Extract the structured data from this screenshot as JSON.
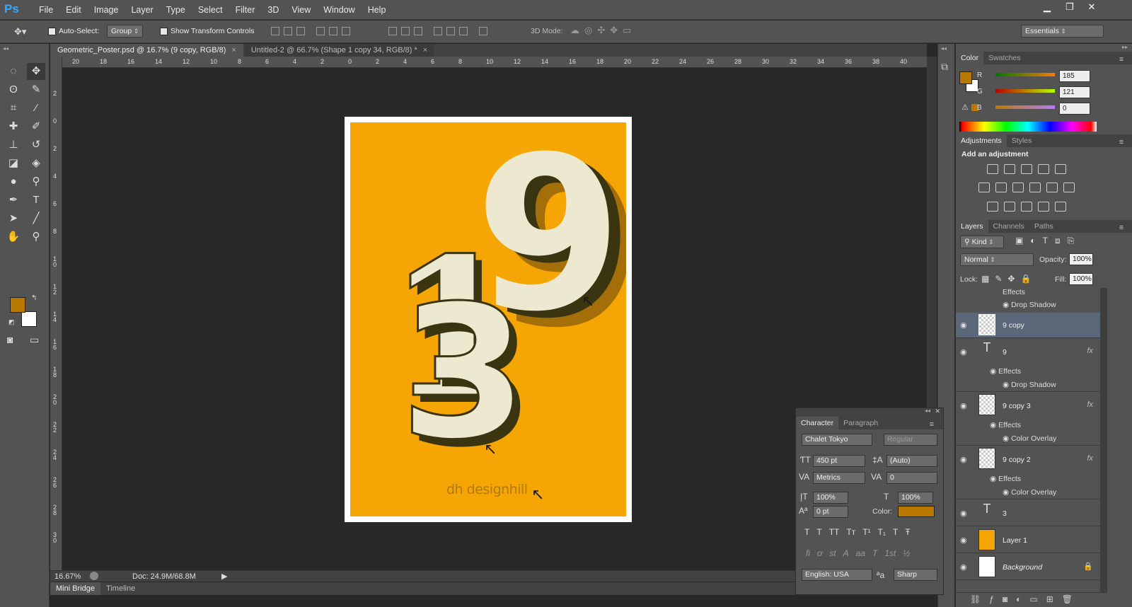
{
  "app": {
    "logo": "Ps"
  },
  "menu": [
    "File",
    "Edit",
    "Image",
    "Layer",
    "Type",
    "Select",
    "Filter",
    "3D",
    "View",
    "Window",
    "Help"
  ],
  "options": {
    "auto_select_label": "Auto-Select:",
    "auto_select_value": "Group",
    "show_transform_label": "Show Transform Controls",
    "mode3d_label": "3D Mode:",
    "workspace": "Essentials"
  },
  "doc_tabs": [
    {
      "label": "Geometric_Poster.psd @ 16.7% (9 copy, RGB/8)",
      "active": true
    },
    {
      "label": "Untitled-2 @ 66.7% (Shape 1 copy 34, RGB/8) *",
      "active": false
    }
  ],
  "ruler_h": [
    "20",
    "18",
    "16",
    "14",
    "12",
    "10",
    "8",
    "6",
    "4",
    "2",
    "0",
    "2",
    "4",
    "6",
    "8",
    "10",
    "12",
    "14",
    "16",
    "18",
    "20",
    "22",
    "24",
    "26",
    "28",
    "30",
    "32",
    "34",
    "36",
    "38",
    "40"
  ],
  "ruler_v": [
    "2",
    "0",
    "2",
    "4",
    "6",
    "8",
    "1 0",
    "1 2",
    "1 4",
    "1 6",
    "1 8",
    "2 0",
    "2 2",
    "2 4",
    "2 6",
    "2 8",
    "3 0"
  ],
  "poster": {
    "big_digits": [
      "1",
      "3",
      "9"
    ],
    "brand": "dh designhill",
    "bg_color": "#f5a504",
    "ink_color": "#ede8d0",
    "shadow_color": "#3a3510"
  },
  "status": {
    "zoom": "16.67%",
    "doc": "Doc: 24.9M/68.8M"
  },
  "bottom_tabs": [
    "Mini Bridge",
    "Timeline"
  ],
  "color_panel": {
    "tabs": [
      "Color",
      "Swatches"
    ],
    "fg_color": "#b97900",
    "r": {
      "label": "R",
      "value": "185"
    },
    "g": {
      "label": "G",
      "value": "121"
    },
    "b": {
      "label": "B",
      "value": "0"
    }
  },
  "adjustments": {
    "tabs": [
      "Adjustments",
      "Styles"
    ],
    "title": "Add an adjustment"
  },
  "layers_panel": {
    "tabs": [
      "Layers",
      "Channels",
      "Paths"
    ],
    "kind": "Kind",
    "blend": "Normal",
    "opacity_label": "Opacity:",
    "opacity": "100%",
    "lock_label": "Lock:",
    "fill_label": "Fill:",
    "fill": "100%",
    "top_effects": "Effects",
    "top_effect": "Drop Shadow",
    "layers": [
      {
        "name": "9 copy",
        "type": "raster",
        "selected": true
      },
      {
        "name": "9",
        "type": "text",
        "fx": "fx",
        "effects": "Effects",
        "effect": "Drop Shadow"
      },
      {
        "name": "9 copy 3",
        "type": "raster",
        "fx": "fx",
        "effects": "Effects",
        "effect": "Color Overlay"
      },
      {
        "name": "9 copy 2",
        "type": "raster",
        "fx": "fx",
        "effects": "Effects",
        "effect": "Color Overlay"
      },
      {
        "name": "3",
        "type": "text"
      },
      {
        "name": "Layer 1",
        "type": "fill",
        "color": "#f5a504"
      },
      {
        "name": "Background",
        "type": "fill",
        "color": "#ffffff"
      }
    ]
  },
  "character": {
    "tabs": [
      "Character",
      "Paragraph"
    ],
    "font": "Chalet Tokyo",
    "style": "Regular",
    "size": "450 pt",
    "leading": "(Auto)",
    "kerning": "Metrics",
    "tracking": "0",
    "vscale": "100%",
    "hscale": "100%",
    "baseline": "0 pt",
    "color_label": "Color:",
    "color": "#b97900",
    "language": "English: USA",
    "aa_label": "a",
    "antialias": "Sharp",
    "style_buttons": [
      "T",
      "T",
      "TT",
      "Tт",
      "T¹",
      "T₁",
      "T",
      "Ŧ"
    ],
    "opentype_buttons": [
      "ﬁ",
      "ơ",
      "st",
      "A",
      "aa",
      "T",
      "1st",
      "½"
    ]
  }
}
